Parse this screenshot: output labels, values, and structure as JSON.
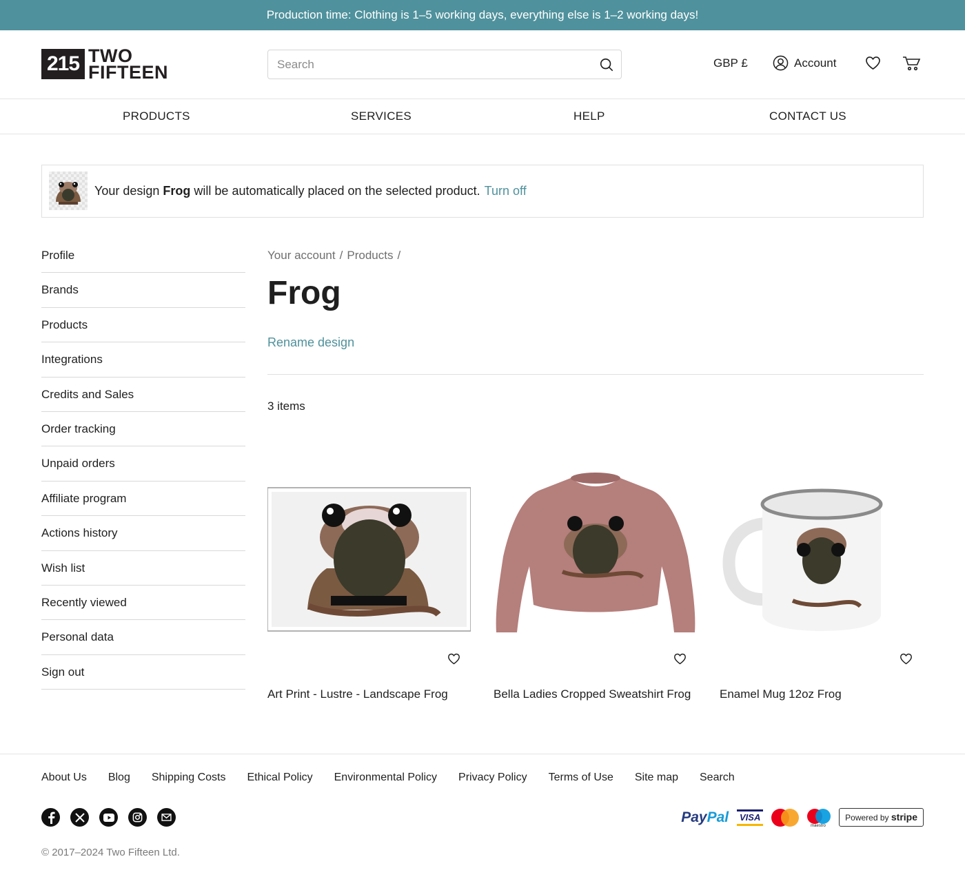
{
  "banner": {
    "text": "Production time: Clothing is 1–5 working days, everything else is 1–2 working days!"
  },
  "header": {
    "logo_mark": "215",
    "logo_line1": "TWO",
    "logo_line2": "FIFTEEN",
    "search_placeholder": "Search",
    "currency": "GBP £",
    "account_label": "Account"
  },
  "nav": [
    "PRODUCTS",
    "SERVICES",
    "HELP",
    "CONTACT US"
  ],
  "notice": {
    "prefix": "Your design ",
    "design_name": "Frog",
    "suffix": " will be automatically placed on the selected product.",
    "link": "Turn off"
  },
  "sidebar": [
    "Profile",
    "Brands",
    "Products",
    "Integrations",
    "Credits and Sales",
    "Order tracking",
    "Unpaid orders",
    "Affiliate program",
    "Actions history",
    "Wish list",
    "Recently viewed",
    "Personal data",
    "Sign out"
  ],
  "breadcrumb": {
    "items": [
      "Your account",
      "Products"
    ],
    "separator": "/"
  },
  "page": {
    "title": "Frog",
    "rename": "Rename design",
    "count": "3 items"
  },
  "products": [
    {
      "name": "Art Print - Lustre - Landscape Frog",
      "image": "art-print"
    },
    {
      "name": "Bella Ladies Cropped Sweatshirt Frog",
      "image": "sweatshirt"
    },
    {
      "name": "Enamel Mug 12oz Frog",
      "image": "mug"
    }
  ],
  "footer": {
    "links": [
      "About Us",
      "Blog",
      "Shipping Costs",
      "Ethical Policy",
      "Environmental Policy",
      "Privacy Policy",
      "Terms of Use",
      "Site map",
      "Search"
    ],
    "social": [
      "facebook-icon",
      "x-icon",
      "youtube-icon",
      "instagram-icon",
      "email-icon"
    ],
    "payments": {
      "paypal_a": "Pay",
      "paypal_b": "Pal",
      "visa": "VISA",
      "maestro": "maestro",
      "stripe_prefix": "Powered by",
      "stripe_brand": "stripe"
    },
    "copyright": "© 2017–2024 Two Fifteen Ltd."
  },
  "colors": {
    "accent": "#4f919c",
    "text": "#1f1f1f",
    "muted": "#6f6f6f"
  }
}
